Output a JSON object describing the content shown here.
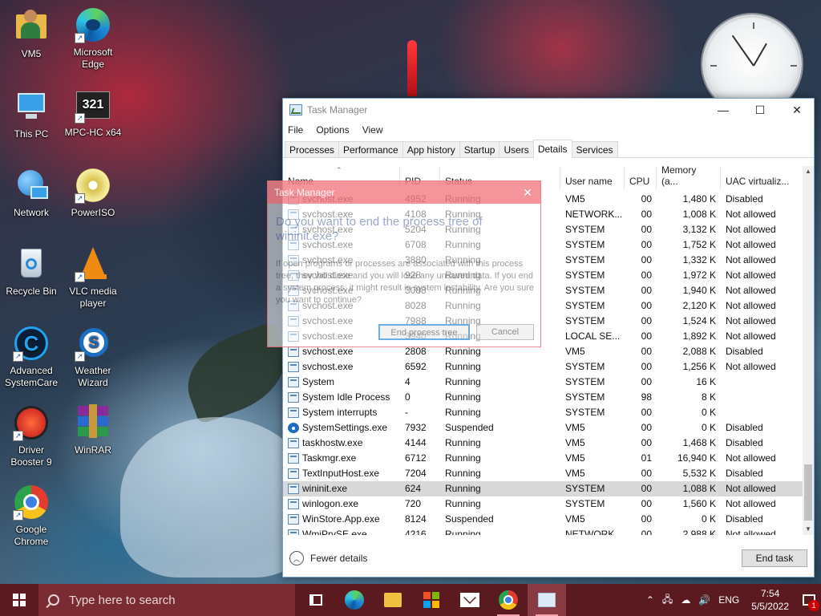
{
  "desktop": {
    "icons": [
      {
        "name": "vm5-folder",
        "label": "VM5"
      },
      {
        "name": "microsoft-edge",
        "label": "Microsoft Edge"
      },
      {
        "name": "this-pc",
        "label": "This PC"
      },
      {
        "name": "mpc-hc",
        "label": "MPC-HC x64"
      },
      {
        "name": "network",
        "label": "Network"
      },
      {
        "name": "poweriso",
        "label": "PowerISO"
      },
      {
        "name": "recycle-bin",
        "label": "Recycle Bin"
      },
      {
        "name": "vlc",
        "label": "VLC media player"
      },
      {
        "name": "advanced-systemcare",
        "label": "Advanced SystemCare"
      },
      {
        "name": "weather-wizard",
        "label": "Weather Wizard"
      },
      {
        "name": "driver-booster",
        "label": "Driver Booster 9"
      },
      {
        "name": "winrar",
        "label": "WinRAR"
      },
      {
        "name": "google-chrome",
        "label": "Google Chrome"
      }
    ]
  },
  "task_manager": {
    "title": "Task Manager",
    "menu": [
      "File",
      "Options",
      "View"
    ],
    "tabs": [
      "Processes",
      "Performance",
      "App history",
      "Startup",
      "Users",
      "Details",
      "Services"
    ],
    "active_tab": "Details",
    "columns": [
      "Name",
      "PID",
      "Status",
      "User name",
      "CPU",
      "Memory (a...",
      "UAC virtualiz..."
    ],
    "rows": [
      {
        "name": "svchost.exe",
        "pid": "4952",
        "status": "Running",
        "user": "VM5",
        "cpu": "00",
        "mem": "1,480 K",
        "uac": "Disabled"
      },
      {
        "name": "svchost.exe",
        "pid": "4108",
        "status": "Running",
        "user": "NETWORK...",
        "cpu": "00",
        "mem": "1,008 K",
        "uac": "Not allowed"
      },
      {
        "name": "svchost.exe",
        "pid": "5204",
        "status": "Running",
        "user": "SYSTEM",
        "cpu": "00",
        "mem": "3,132 K",
        "uac": "Not allowed"
      },
      {
        "name": "svchost.exe",
        "pid": "6708",
        "status": "Running",
        "user": "SYSTEM",
        "cpu": "00",
        "mem": "1,752 K",
        "uac": "Not allowed"
      },
      {
        "name": "svchost.exe",
        "pid": "3880",
        "status": "Running",
        "user": "SYSTEM",
        "cpu": "00",
        "mem": "1,332 K",
        "uac": "Not allowed"
      },
      {
        "name": "svchost.exe",
        "pid": "928",
        "status": "Running",
        "user": "SYSTEM",
        "cpu": "00",
        "mem": "1,972 K",
        "uac": "Not allowed"
      },
      {
        "name": "svchost.exe",
        "pid": "3088",
        "status": "Running",
        "user": "SYSTEM",
        "cpu": "00",
        "mem": "1,940 K",
        "uac": "Not allowed"
      },
      {
        "name": "svchost.exe",
        "pid": "8028",
        "status": "Running",
        "user": "SYSTEM",
        "cpu": "00",
        "mem": "2,120 K",
        "uac": "Not allowed"
      },
      {
        "name": "svchost.exe",
        "pid": "7988",
        "status": "Running",
        "user": "SYSTEM",
        "cpu": "00",
        "mem": "1,524 K",
        "uac": "Not allowed"
      },
      {
        "name": "svchost.exe",
        "pid": "3940",
        "status": "Running",
        "user": "LOCAL SE...",
        "cpu": "00",
        "mem": "1,892 K",
        "uac": "Not allowed"
      },
      {
        "name": "svchost.exe",
        "pid": "2808",
        "status": "Running",
        "user": "VM5",
        "cpu": "00",
        "mem": "2,088 K",
        "uac": "Disabled"
      },
      {
        "name": "svchost.exe",
        "pid": "6592",
        "status": "Running",
        "user": "SYSTEM",
        "cpu": "00",
        "mem": "1,256 K",
        "uac": "Not allowed"
      },
      {
        "name": "System",
        "pid": "4",
        "status": "Running",
        "user": "SYSTEM",
        "cpu": "00",
        "mem": "16 K",
        "uac": ""
      },
      {
        "name": "System Idle Process",
        "pid": "0",
        "status": "Running",
        "user": "SYSTEM",
        "cpu": "98",
        "mem": "8 K",
        "uac": ""
      },
      {
        "name": "System interrupts",
        "pid": "-",
        "status": "Running",
        "user": "SYSTEM",
        "cpu": "00",
        "mem": "0 K",
        "uac": ""
      },
      {
        "name": "SystemSettings.exe",
        "pid": "7932",
        "status": "Suspended",
        "user": "VM5",
        "cpu": "00",
        "mem": "0 K",
        "uac": "Disabled"
      },
      {
        "name": "taskhostw.exe",
        "pid": "4144",
        "status": "Running",
        "user": "VM5",
        "cpu": "00",
        "mem": "1,468 K",
        "uac": "Disabled"
      },
      {
        "name": "Taskmgr.exe",
        "pid": "6712",
        "status": "Running",
        "user": "VM5",
        "cpu": "01",
        "mem": "16,940 K",
        "uac": "Not allowed"
      },
      {
        "name": "TextInputHost.exe",
        "pid": "7204",
        "status": "Running",
        "user": "VM5",
        "cpu": "00",
        "mem": "5,532 K",
        "uac": "Disabled"
      },
      {
        "name": "wininit.exe",
        "pid": "624",
        "status": "Running",
        "user": "SYSTEM",
        "cpu": "00",
        "mem": "1,088 K",
        "uac": "Not allowed"
      },
      {
        "name": "winlogon.exe",
        "pid": "720",
        "status": "Running",
        "user": "SYSTEM",
        "cpu": "00",
        "mem": "1,560 K",
        "uac": "Not allowed"
      },
      {
        "name": "WinStore.App.exe",
        "pid": "8124",
        "status": "Suspended",
        "user": "VM5",
        "cpu": "00",
        "mem": "0 K",
        "uac": "Disabled"
      },
      {
        "name": "WmiPrvSE.exe",
        "pid": "4216",
        "status": "Running",
        "user": "NETWORK...",
        "cpu": "00",
        "mem": "2,988 K",
        "uac": "Not allowed"
      }
    ],
    "selected_row": "wininit.exe",
    "fewer_details": "Fewer details",
    "end_task": "End task"
  },
  "dialog": {
    "title": "Task Manager",
    "heading": "Do you want to end the process tree of wininit.exe?",
    "body": "If open programs or processes are associated with this process tree, they will close and you will lose any unsaved data. If you end a system process, it might result in system instability. Are you sure you want to continue?",
    "end_tree_button": "End process tree",
    "cancel_button": "Cancel"
  },
  "taskbar": {
    "search_placeholder": "Type here to search",
    "language": "ENG",
    "time": "7:54",
    "date": "5/5/2022",
    "notification_count": "1"
  },
  "colors": {
    "taskbar": "#5a1a20",
    "search_box": "#7b2b32",
    "selected_row": "#d9d9d9",
    "dialog_accent": "#e8505a"
  }
}
